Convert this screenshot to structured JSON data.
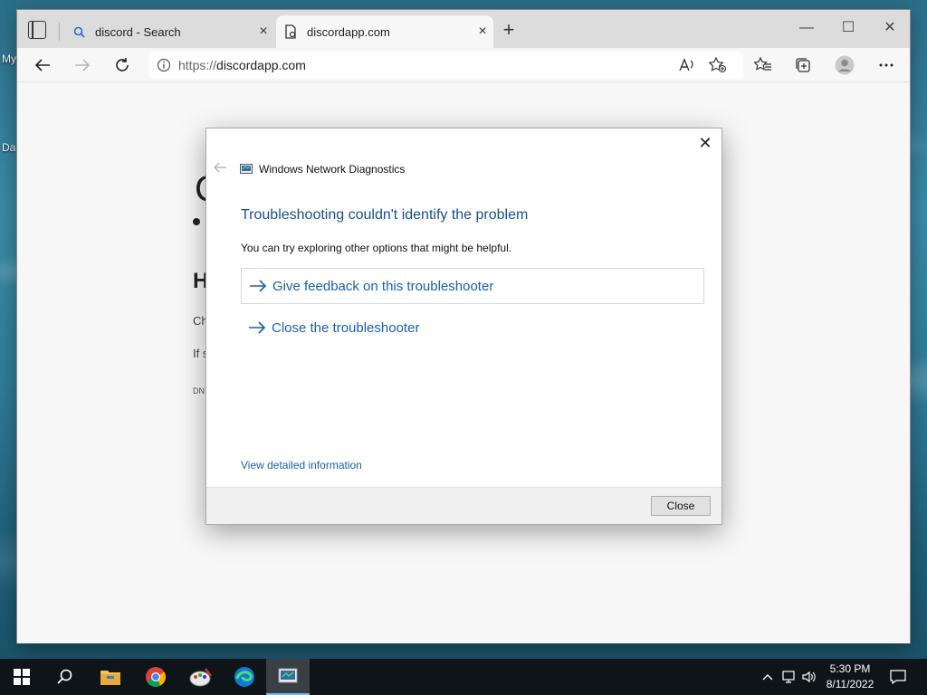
{
  "desktop": {
    "icon_labels": [
      "My",
      "Da"
    ]
  },
  "browser": {
    "tabs": [
      {
        "title": "discord - Search",
        "icon": "search-icon",
        "close": "×"
      },
      {
        "title": "discordapp.com",
        "icon": "page-icon",
        "close": "×"
      }
    ],
    "new_tab": "+",
    "window_controls": {
      "minimize": "—",
      "maximize": "☐",
      "close": "✕"
    },
    "address": {
      "scheme": "https://",
      "host": "discordapp.com"
    },
    "page_fragments": {
      "heading_char": "H",
      "line1": "Ch",
      "line2": "If s",
      "code": "DN",
      "logo_char": "C"
    }
  },
  "dialog": {
    "app_title": "Windows Network Diagnostics",
    "heading": "Troubleshooting couldn't identify the problem",
    "subtext": "You can try exploring other options that might be helpful.",
    "options": [
      {
        "label": "Give feedback on this troubleshooter"
      },
      {
        "label": "Close the troubleshooter"
      }
    ],
    "details_link": "View detailed information",
    "close_button": "Close",
    "close_x": "✕"
  },
  "taskbar": {
    "clock": {
      "time": "5:30 PM",
      "date": "8/11/2022"
    },
    "apps": [
      "start-icon",
      "search-icon",
      "file-explorer-icon",
      "chrome-icon",
      "paint-icon",
      "edge-icon",
      "network-diagnostics-icon"
    ]
  },
  "colors": {
    "accent_link": "#1a5fb4",
    "heading_blue": "#1a4f8e",
    "taskbar": "#0f1418"
  }
}
